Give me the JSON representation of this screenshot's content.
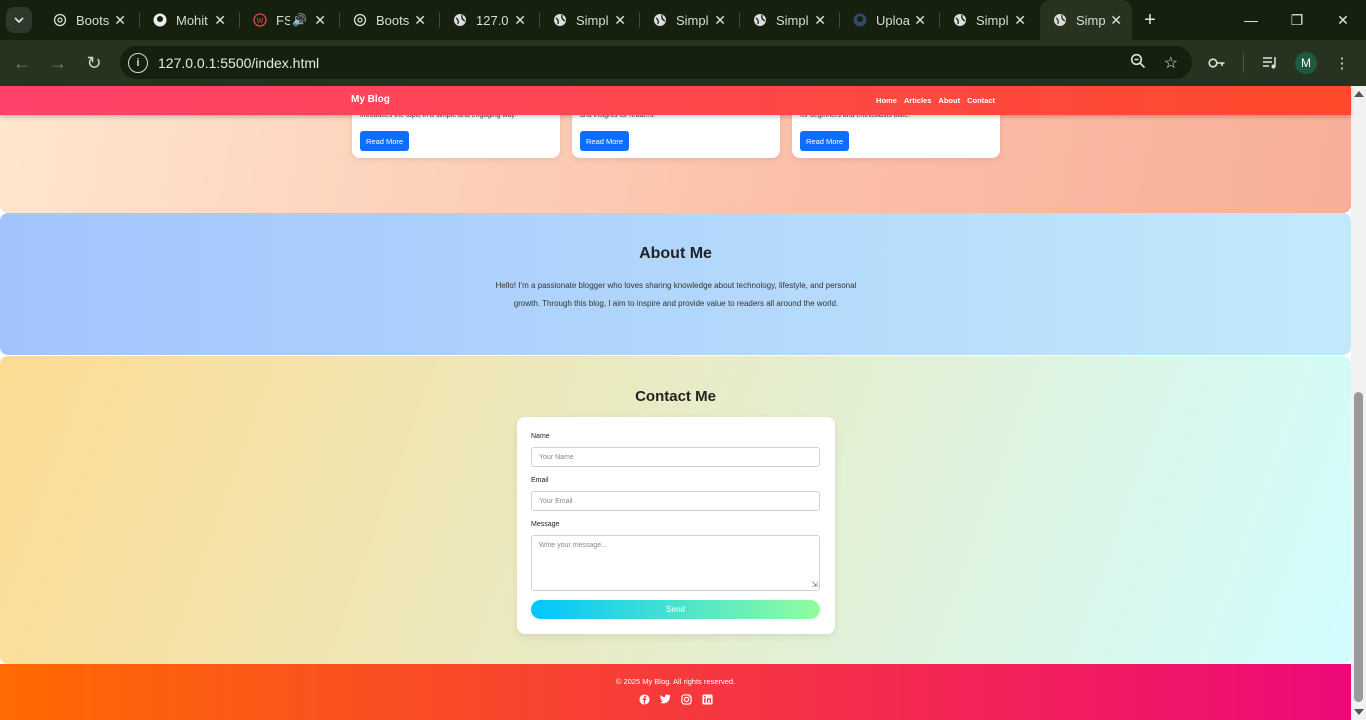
{
  "browser": {
    "tabs": [
      {
        "title": "Boots",
        "icon": "chatgpt-icon"
      },
      {
        "title": "Mohit",
        "icon": "github-icon"
      },
      {
        "title": "FS",
        "icon": "w-icon",
        "audio": true
      },
      {
        "title": "Boots",
        "icon": "chatgpt-icon"
      },
      {
        "title": "127.0",
        "icon": "globe-icon"
      },
      {
        "title": "Simpl",
        "icon": "globe-icon"
      },
      {
        "title": "Simpl",
        "icon": "globe-icon"
      },
      {
        "title": "Simpl",
        "icon": "globe-icon"
      },
      {
        "title": "Uploa",
        "icon": "github-icon"
      },
      {
        "title": "Simpl",
        "icon": "globe-icon"
      },
      {
        "title": "Simpl",
        "icon": "globe-icon",
        "active": true
      }
    ],
    "url": "127.0.0.1:5500/index.html",
    "profile_initial": "M"
  },
  "site": {
    "brand": "My Blog",
    "nav": [
      "Home",
      "Articles",
      "About",
      "Contact"
    ]
  },
  "articles": {
    "cards": [
      {
        "desc": "introduces the topic in a simple and engaging way.",
        "button": "Read More"
      },
      {
        "desc": "and insights for readers.",
        "button": "Read More"
      },
      {
        "desc": "for beginners and enthusiasts alike.",
        "button": "Read More"
      }
    ]
  },
  "about": {
    "title": "About Me",
    "text": "Hello! I'm a passionate blogger who loves sharing knowledge about technology, lifestyle, and personal growth. Through this blog, I aim to inspire and provide value to readers all around the world."
  },
  "contact": {
    "title": "Contact Me",
    "name_label": "Name",
    "name_placeholder": "Your Name",
    "email_label": "Email",
    "email_placeholder": "Your Email",
    "message_label": "Message",
    "message_placeholder": "Write your message...",
    "send_label": "Send"
  },
  "footer": {
    "copyright": "© 2025 My Blog. All rights reserved.",
    "socials": [
      "facebook-icon",
      "twitter-icon",
      "instagram-icon",
      "linkedin-icon"
    ]
  },
  "colors": {
    "nav_gradient": [
      "#ff416c",
      "#ff4b2b"
    ],
    "button_primary": "#0d6efd",
    "footer_gradient": [
      "#ff6a00",
      "#ee0979"
    ]
  }
}
